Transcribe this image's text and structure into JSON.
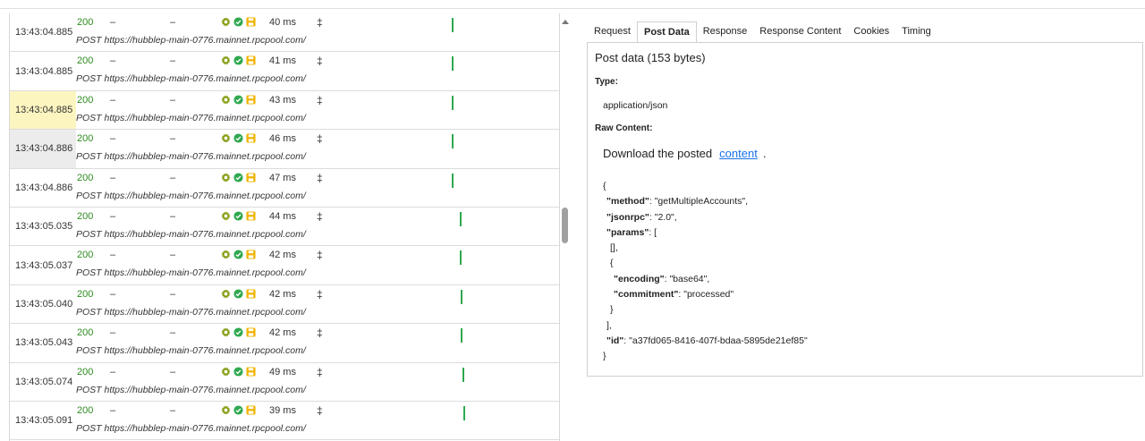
{
  "requests": [
    {
      "time": "13:43:04.885",
      "status": "200",
      "type_dash": "–",
      "size_dash": "–",
      "duration": "40 ms",
      "sort_glyph": "‡",
      "url": "POST https://hubblep-main-0776.mainnet.rpcpool.com/",
      "highlight": "none"
    },
    {
      "time": "13:43:04.885",
      "status": "200",
      "type_dash": "–",
      "size_dash": "–",
      "duration": "41 ms",
      "sort_glyph": "‡",
      "url": "POST https://hubblep-main-0776.mainnet.rpcpool.com/",
      "highlight": "none"
    },
    {
      "time": "13:43:04.885",
      "status": "200",
      "type_dash": "–",
      "size_dash": "–",
      "duration": "43 ms",
      "sort_glyph": "‡",
      "url": "POST https://hubblep-main-0776.mainnet.rpcpool.com/",
      "highlight": "yellow"
    },
    {
      "time": "13:43:04.886",
      "status": "200",
      "type_dash": "–",
      "size_dash": "–",
      "duration": "46 ms",
      "sort_glyph": "‡",
      "url": "POST https://hubblep-main-0776.mainnet.rpcpool.com/",
      "highlight": "gray"
    },
    {
      "time": "13:43:04.886",
      "status": "200",
      "type_dash": "–",
      "size_dash": "–",
      "duration": "47 ms",
      "sort_glyph": "‡",
      "url": "POST https://hubblep-main-0776.mainnet.rpcpool.com/",
      "highlight": "none"
    },
    {
      "time": "13:43:05.035",
      "status": "200",
      "type_dash": "–",
      "size_dash": "–",
      "duration": "44 ms",
      "sort_glyph": "‡",
      "url": "POST https://hubblep-main-0776.mainnet.rpcpool.com/",
      "highlight": "none"
    },
    {
      "time": "13:43:05.037",
      "status": "200",
      "type_dash": "–",
      "size_dash": "–",
      "duration": "42 ms",
      "sort_glyph": "‡",
      "url": "POST https://hubblep-main-0776.mainnet.rpcpool.com/",
      "highlight": "none"
    },
    {
      "time": "13:43:05.040",
      "status": "200",
      "type_dash": "–",
      "size_dash": "–",
      "duration": "42 ms",
      "sort_glyph": "‡",
      "url": "POST https://hubblep-main-0776.mainnet.rpcpool.com/",
      "highlight": "none"
    },
    {
      "time": "13:43:05.043",
      "status": "200",
      "type_dash": "–",
      "size_dash": "–",
      "duration": "42 ms",
      "sort_glyph": "‡",
      "url": "POST https://hubblep-main-0776.mainnet.rpcpool.com/",
      "highlight": "none"
    },
    {
      "time": "13:43:05.074",
      "status": "200",
      "type_dash": "–",
      "size_dash": "–",
      "duration": "49 ms",
      "sort_glyph": "‡",
      "url": "POST https://hubblep-main-0776.mainnet.rpcpool.com/",
      "highlight": "none"
    },
    {
      "time": "13:43:05.091",
      "status": "200",
      "type_dash": "–",
      "size_dash": "–",
      "duration": "39 ms",
      "sort_glyph": "‡",
      "url": "POST https://hubblep-main-0776.mainnet.rpcpool.com/",
      "highlight": "none"
    }
  ],
  "row_icons": [
    "gear-icon",
    "check-circle-icon",
    "save-icon"
  ],
  "colors": {
    "status_ok": "#2e8b1f",
    "timeline_bar": "#2fa84f",
    "gear": "#8aa21e",
    "check": "#2fa84f",
    "save": "#f0b400",
    "link": "#1a73e8",
    "highlight_yellow": "#fdf5c0"
  },
  "tabs": [
    {
      "label": "Request",
      "active": false
    },
    {
      "label": "Post Data",
      "active": true
    },
    {
      "label": "Response",
      "active": false
    },
    {
      "label": "Response Content",
      "active": false
    },
    {
      "label": "Cookies",
      "active": false
    },
    {
      "label": "Timing",
      "active": false
    }
  ],
  "post_data": {
    "title": "Post data (153 bytes)",
    "type_label": "Type:",
    "type_value": "application/json",
    "raw_label": "Raw Content:",
    "download_text": "Download the posted",
    "download_link": "content",
    "download_suffix": ".",
    "json_lines": [
      {
        "indent": 0,
        "key": "",
        "rest": "{"
      },
      {
        "indent": 1,
        "key": "\"method\"",
        "rest": ": \"getMultipleAccounts\","
      },
      {
        "indent": 1,
        "key": "\"jsonrpc\"",
        "rest": ": \"2.0\","
      },
      {
        "indent": 1,
        "key": "\"params\"",
        "rest": ": ["
      },
      {
        "indent": 2,
        "key": "",
        "rest": "[],"
      },
      {
        "indent": 2,
        "key": "",
        "rest": "{"
      },
      {
        "indent": 3,
        "key": "\"encoding\"",
        "rest": ": \"base64\","
      },
      {
        "indent": 3,
        "key": "\"commitment\"",
        "rest": ": \"processed\""
      },
      {
        "indent": 2,
        "key": "",
        "rest": "}"
      },
      {
        "indent": 1,
        "key": "",
        "rest": "],"
      },
      {
        "indent": 1,
        "key": "\"id\"",
        "rest": ": \"a37fd065-8416-407f-bdaa-5895de21ef85\""
      },
      {
        "indent": 0,
        "key": "",
        "rest": "}"
      }
    ]
  }
}
